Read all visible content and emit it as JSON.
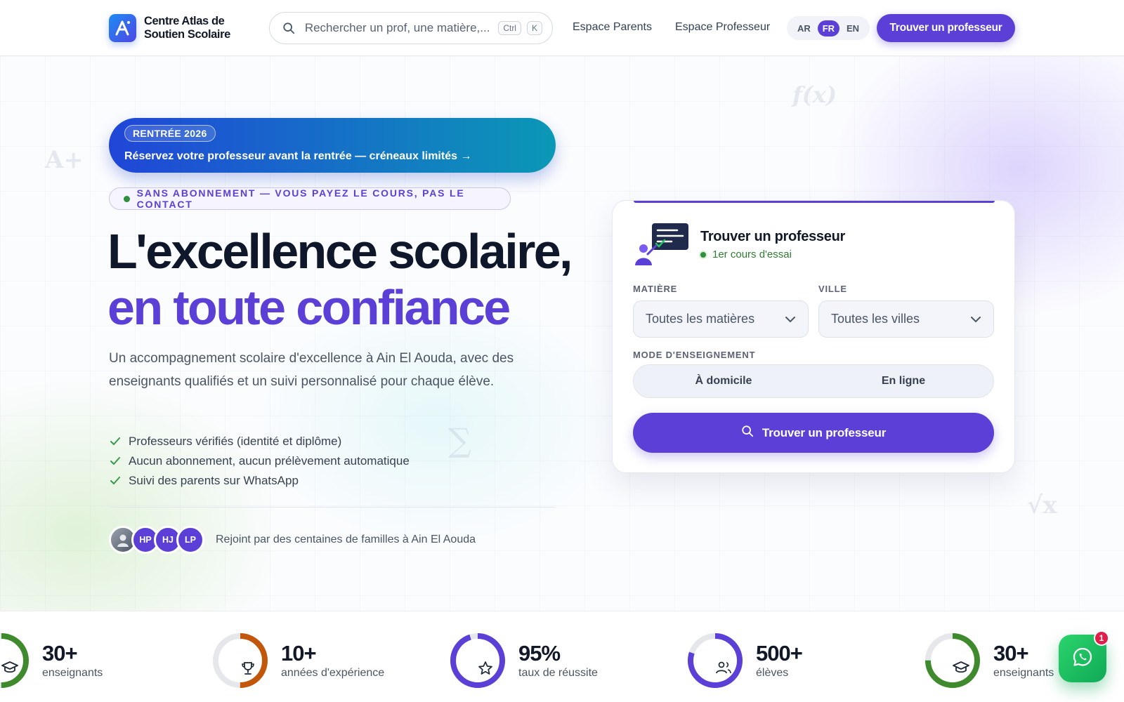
{
  "header": {
    "brand_line1": "Centre Atlas de",
    "brand_line2": "Soutien Scolaire",
    "search_placeholder": "Rechercher un prof, une matière,...",
    "shortcut_ctrl": "Ctrl",
    "shortcut_key": "K",
    "nav": [
      "Espace Parents",
      "Espace Professeur"
    ],
    "languages": [
      "AR",
      "FR",
      "EN"
    ],
    "active_language": "FR",
    "cta": "Trouver un professeur"
  },
  "hero": {
    "promo_tag": "RENTRÉE 2026",
    "promo_text": "Réservez votre professeur avant la rentrée — créneaux limités →",
    "pill": "SANS ABONNEMENT — VOUS PAYEZ LE COURS, PAS LE CONTACT",
    "title_line1": "L'excellence scolaire,",
    "title_line2": "en toute confiance",
    "lead": "Un accompagnement scolaire d'excellence à Ain El Aouda, avec des enseignants qualifiés et un suivi personnalisé pour chaque élève.",
    "checks": [
      "Professeurs vérifiés (identité et diplôme)",
      "Aucun abonnement, aucun prélèvement automatique",
      "Suivi des parents sur WhatsApp"
    ],
    "avatars": [
      "HP",
      "HJ",
      "LP"
    ],
    "social_proof": "Rejoint par des centaines de familles à Ain El Aouda",
    "decor_symbols": [
      "A+",
      "f(x)",
      "∑",
      "√x"
    ]
  },
  "search_card": {
    "title": "Trouver un professeur",
    "badge": "1er cours d'essai",
    "subject_label": "MATIÈRE",
    "subject_value": "Toutes les matières",
    "city_label": "VILLE",
    "city_value": "Toutes les villes",
    "mode_label": "MODE D'ENSEIGNEMENT",
    "modes": [
      "À domicile",
      "En ligne"
    ],
    "cta": "Trouver un professeur"
  },
  "stats": [
    {
      "value": "30+",
      "label": "enseignants",
      "icon": "graduation-cap-icon",
      "color": "#3f8a2c",
      "fill": 0.5
    },
    {
      "value": "10+",
      "label": "années d'expérience",
      "icon": "trophy-icon",
      "color": "#c2570c",
      "fill": 0.5
    },
    {
      "value": "95%",
      "label": "taux de réussite",
      "icon": "star-icon",
      "color": "#5b3fd6",
      "fill": 0.95
    },
    {
      "value": "500+",
      "label": "élèves",
      "icon": "users-icon",
      "color": "#5b3fd6",
      "fill": 0.8
    },
    {
      "value": "30+",
      "label": "enseignants",
      "icon": "graduation-cap-icon",
      "color": "#3f8a2c",
      "fill": 0.75
    }
  ],
  "whatsapp": {
    "badge_count": "1"
  },
  "colors": {
    "primary": "#5b3fd6",
    "success": "#2f8f3e",
    "promo_start": "#2046d8",
    "promo_end": "#0b98b6"
  }
}
